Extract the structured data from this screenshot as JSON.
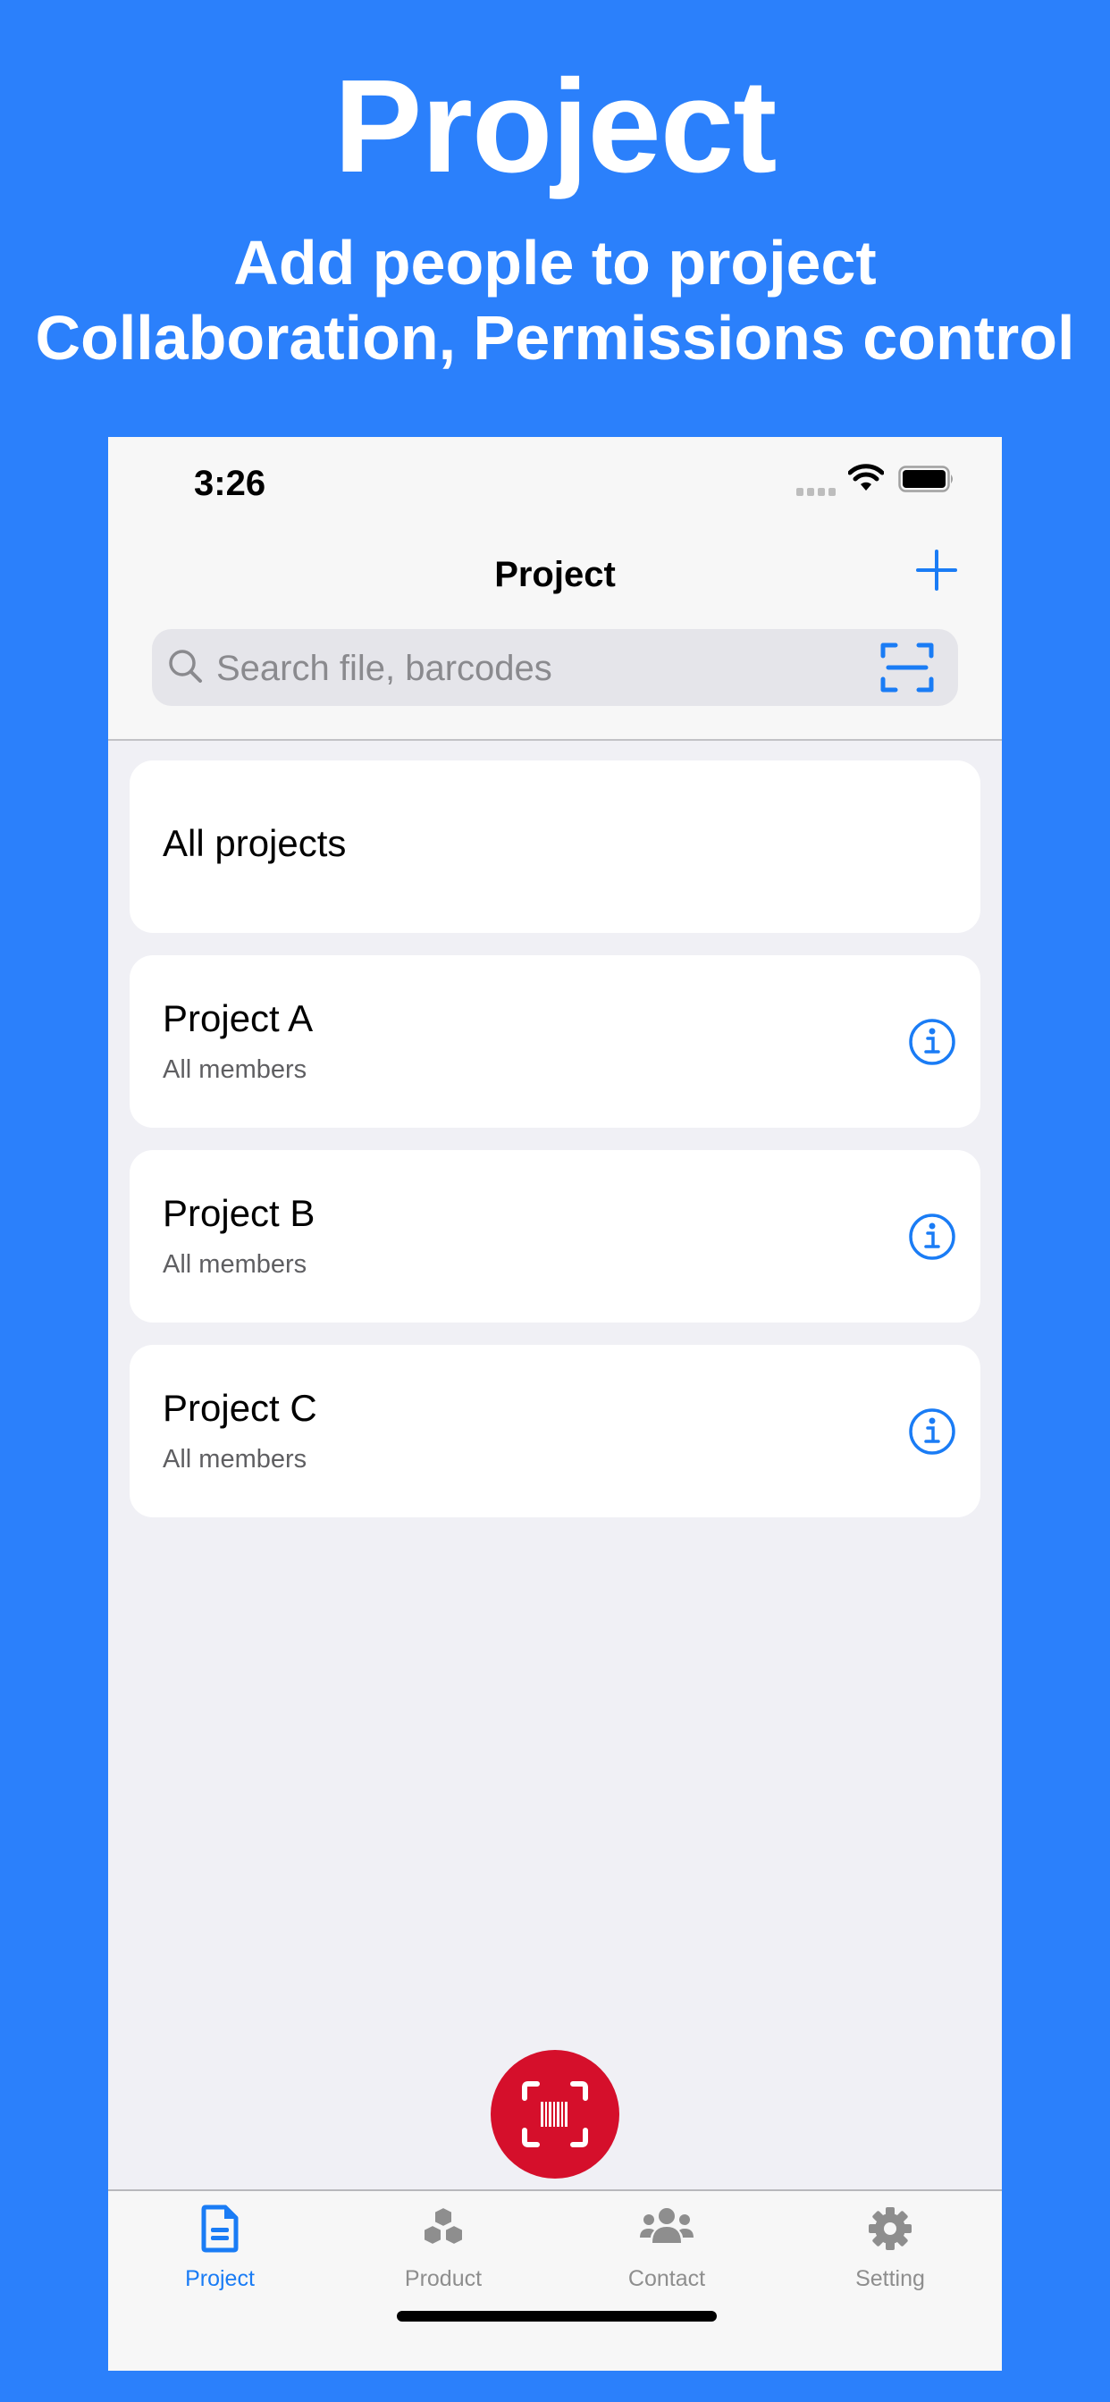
{
  "promo": {
    "title": "Project",
    "subtitle_line1": "Add people to project",
    "subtitle_line2": "Collaboration, Permissions control"
  },
  "colors": {
    "background": "#2b80fb",
    "accent": "#1a7cf5",
    "scan_button": "#d50f2b",
    "inactive_tab": "#8e8e8e"
  },
  "status_bar": {
    "time": "3:26",
    "icons": [
      "signal-icon",
      "wifi-icon",
      "battery-icon"
    ]
  },
  "nav": {
    "title": "Project",
    "add_icon": "plus-icon"
  },
  "search": {
    "value": "",
    "placeholder": "Search file, barcodes",
    "left_icon": "search-icon",
    "right_icon": "scan-icon"
  },
  "list": {
    "all_projects_label": "All projects",
    "projects": [
      {
        "name": "Project A",
        "members": "All members",
        "icon": "info-icon"
      },
      {
        "name": "Project B",
        "members": "All members",
        "icon": "info-icon"
      },
      {
        "name": "Project C",
        "members": "All members",
        "icon": "info-icon"
      }
    ]
  },
  "fab": {
    "icon": "barcode-scan-icon"
  },
  "tabbar": {
    "tabs": [
      {
        "label": "Project",
        "icon": "document-icon",
        "active": true
      },
      {
        "label": "Product",
        "icon": "cubes-icon",
        "active": false
      },
      {
        "label": "Contact",
        "icon": "people-icon",
        "active": false
      },
      {
        "label": "Setting",
        "icon": "gear-icon",
        "active": false
      }
    ]
  }
}
